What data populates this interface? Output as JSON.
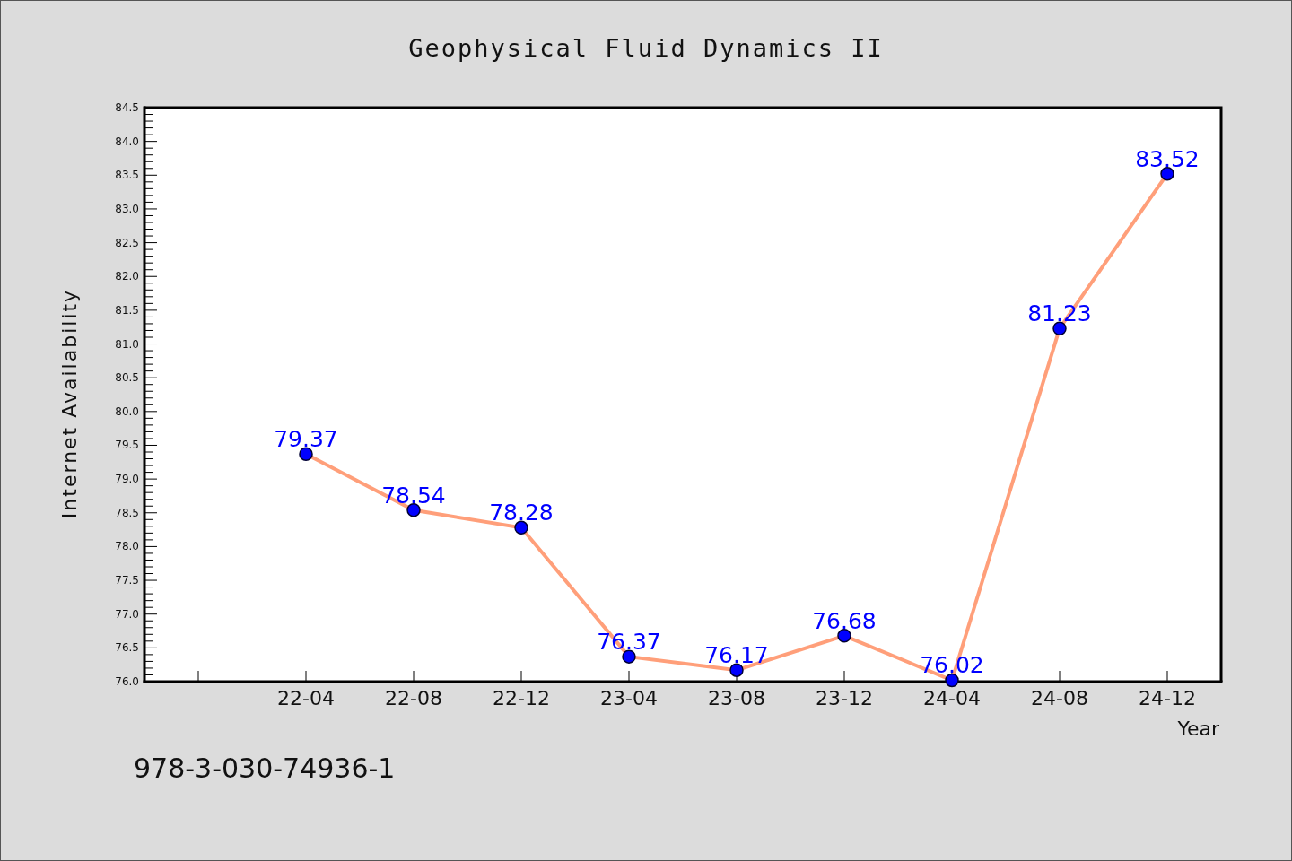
{
  "chart_data": {
    "type": "line",
    "title": "Geophysical Fluid Dynamics II",
    "xlabel": "Year",
    "ylabel": "Internet Availability",
    "categories": [
      "22-04",
      "22-08",
      "22-12",
      "23-04",
      "23-08",
      "23-12",
      "24-04",
      "24-08",
      "24-12"
    ],
    "series": [
      {
        "color": "#ff9f7a",
        "marker": "circle",
        "values": [
          79.37,
          78.54,
          78.28,
          76.37,
          76.17,
          76.68,
          76.02,
          81.23,
          83.52
        ]
      }
    ],
    "ylim": [
      76,
      84.5
    ],
    "yticks": [
      {
        "value": 76,
        "label": "76.0"
      },
      {
        "value": 76.5,
        "label": "76.5"
      },
      {
        "value": 77,
        "label": "77.0"
      },
      {
        "value": 77.5,
        "label": "77.5"
      },
      {
        "value": 78,
        "label": "78.0"
      },
      {
        "value": 78.5,
        "label": "78.5"
      },
      {
        "value": 79,
        "label": "79.0"
      },
      {
        "value": 79.5,
        "label": "79.5"
      },
      {
        "value": 80,
        "label": "80.0"
      },
      {
        "value": 80.5,
        "label": "80.5"
      },
      {
        "value": 81,
        "label": "81.0"
      },
      {
        "value": 81.5,
        "label": "81.5"
      },
      {
        "value": 82,
        "label": "82.0"
      },
      {
        "value": 82.5,
        "label": "82.5"
      },
      {
        "value": 83,
        "label": "83.0"
      },
      {
        "value": 83.5,
        "label": "83.5"
      },
      {
        "value": 84,
        "label": "84.0"
      },
      {
        "value": 84.5,
        "label": "84.5"
      }
    ],
    "data_labels": true
  },
  "footer_text": "978-3-030-74936-1"
}
